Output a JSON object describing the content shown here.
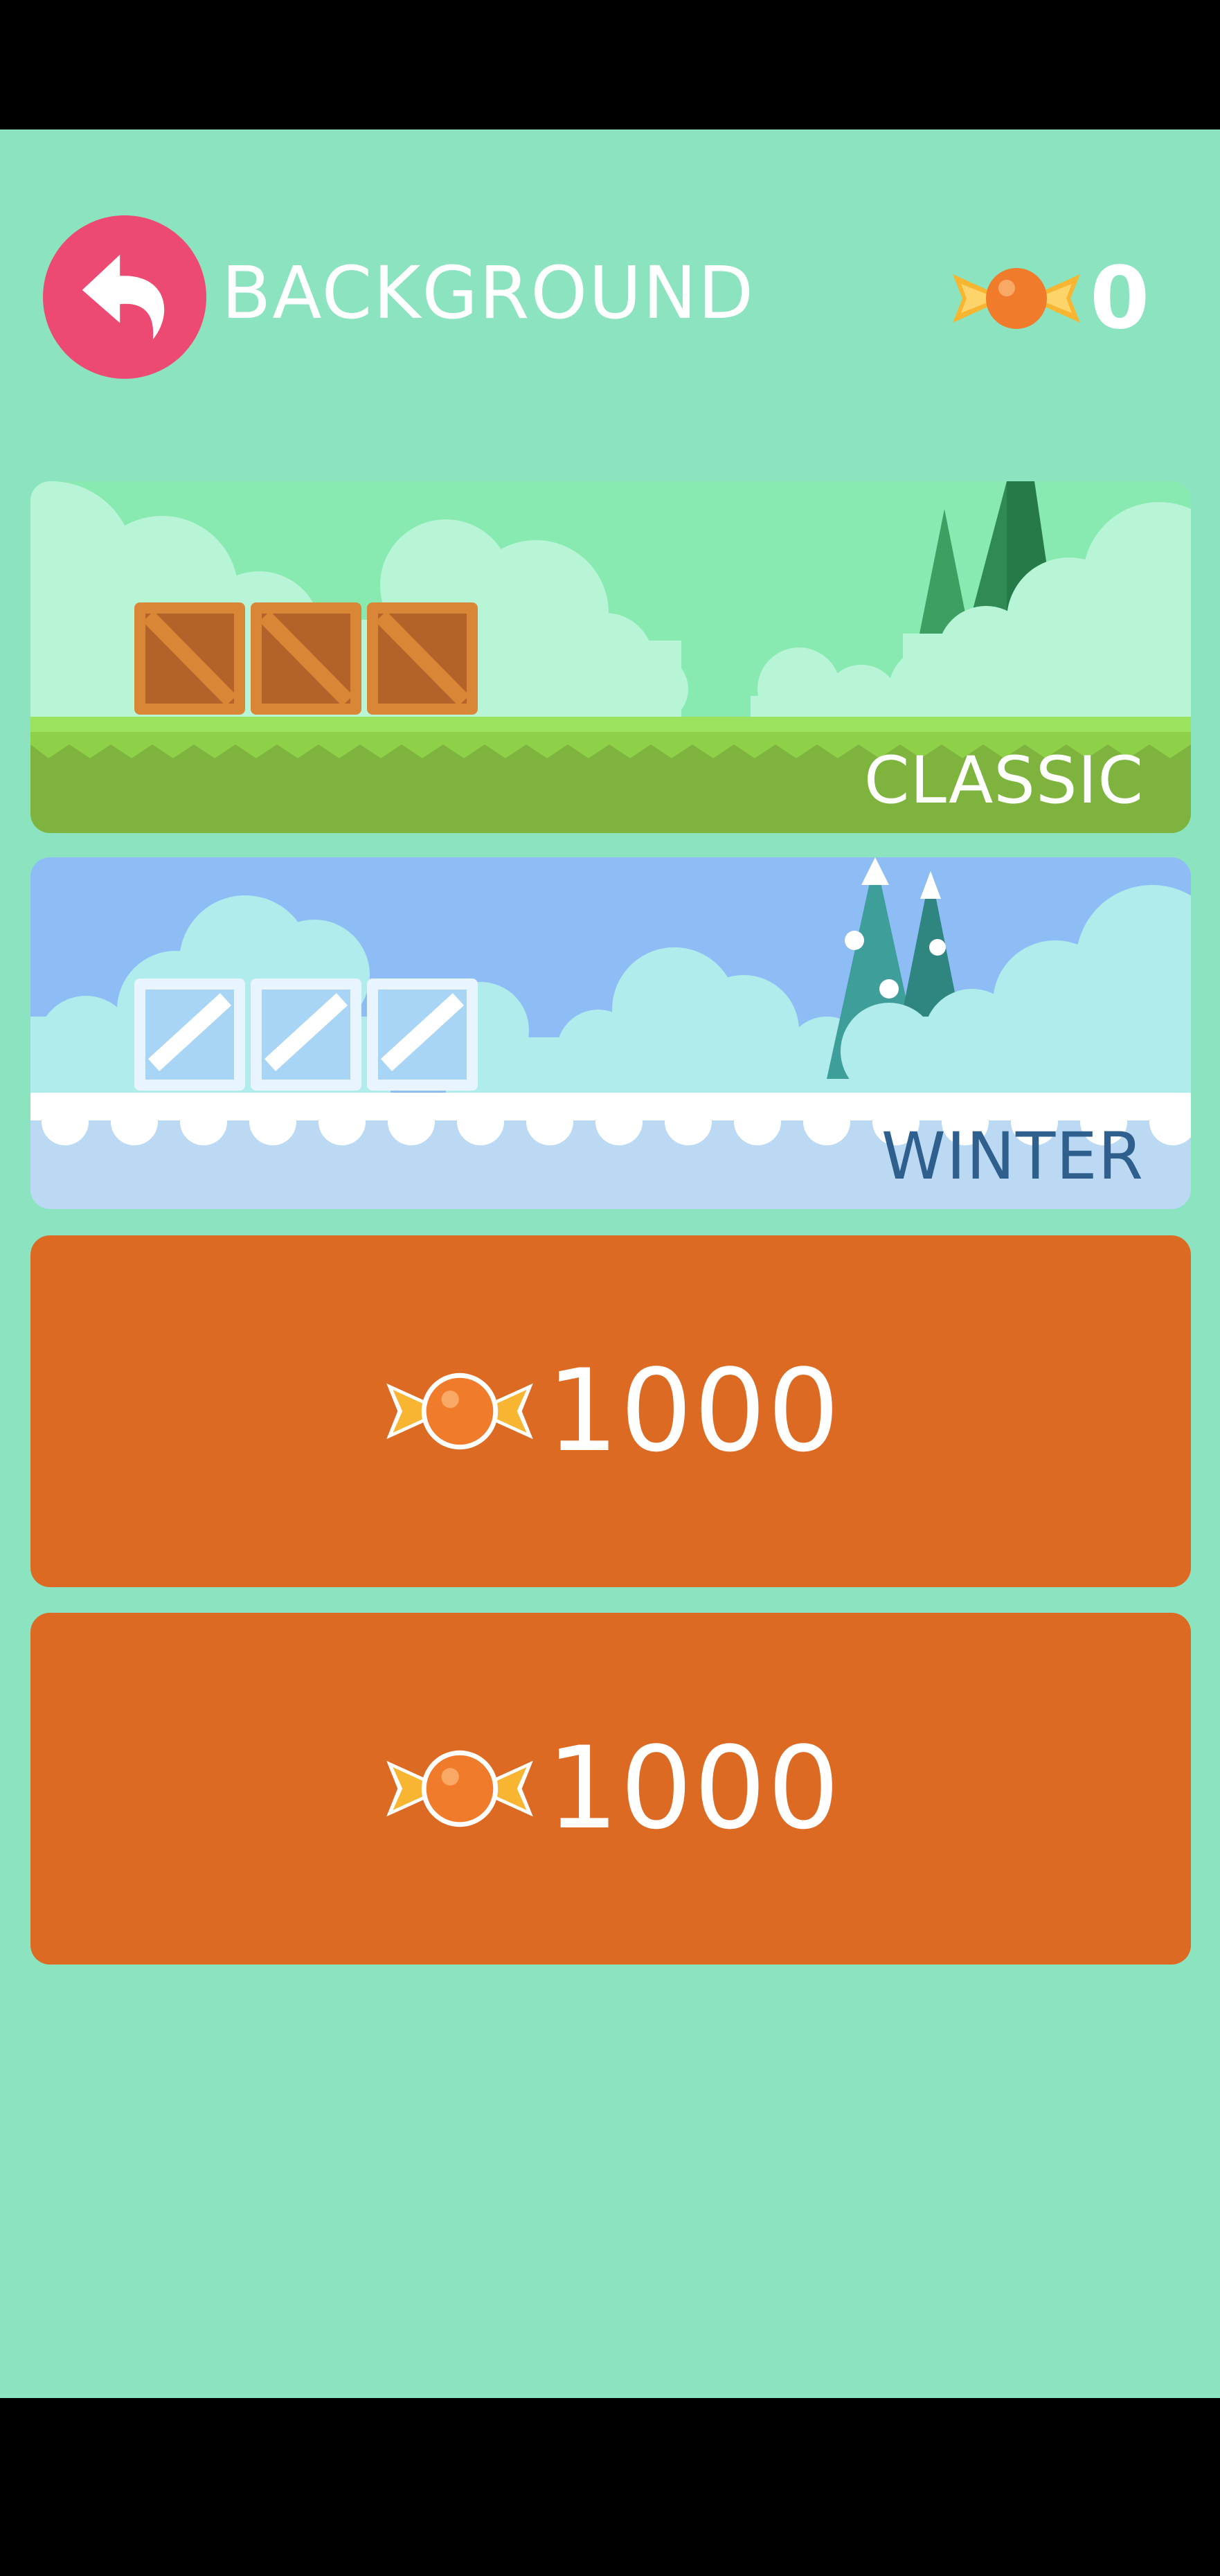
{
  "header": {
    "title": "BACKGROUND",
    "back_icon": "back-arrow-icon",
    "candy_icon": "candy-icon",
    "candy_count": "0"
  },
  "backgrounds": [
    {
      "label": "CLASSIC",
      "state": "owned"
    },
    {
      "label": "WINTER",
      "state": "owned"
    },
    {
      "price": "1000",
      "state": "locked",
      "currency_icon": "candy-icon"
    },
    {
      "price": "1000",
      "state": "locked",
      "currency_icon": "candy-icon"
    }
  ],
  "colors": {
    "background": "#8be4bf",
    "back_button": "#ec4a72",
    "locked_card": "#dc6a22",
    "candy": "#f07b2a",
    "candy_wrapper": "#f8b531"
  }
}
